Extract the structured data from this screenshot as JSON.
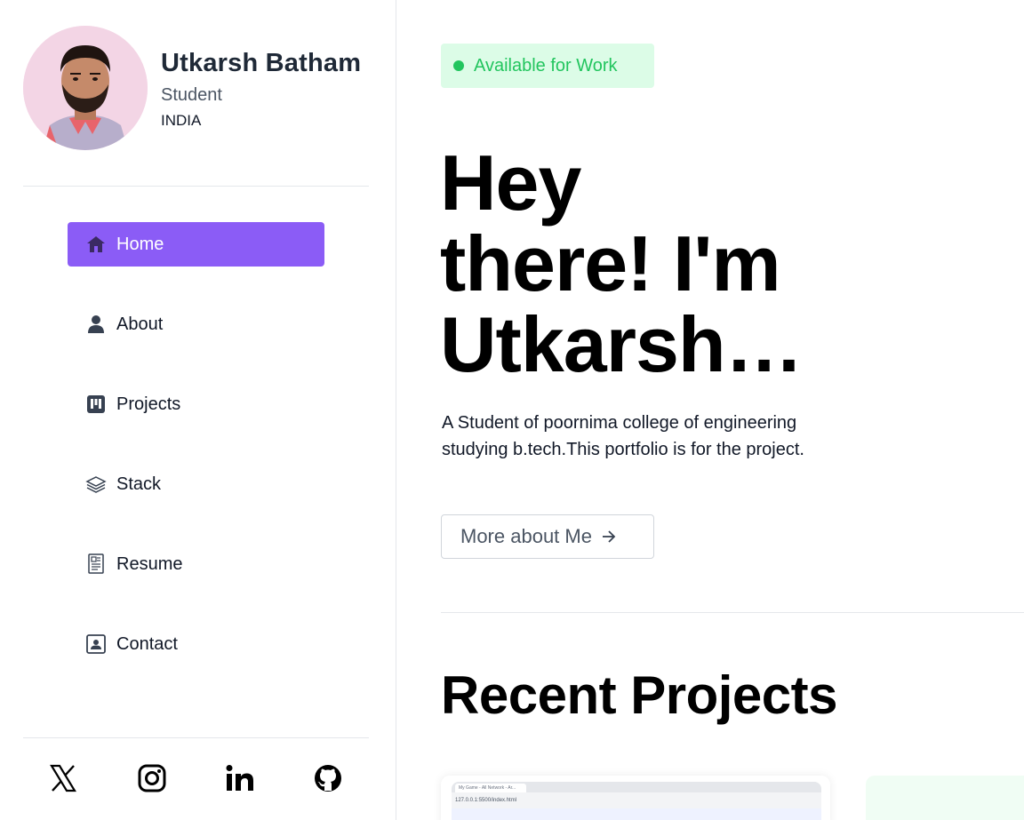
{
  "profile": {
    "name": "Utkarsh Batham",
    "role": "Student",
    "country": "INDIA"
  },
  "nav": {
    "items": [
      {
        "label": "Home",
        "icon": "home-icon",
        "active": true
      },
      {
        "label": "About",
        "icon": "user-icon",
        "active": false
      },
      {
        "label": "Projects",
        "icon": "kanban-icon",
        "active": false
      },
      {
        "label": "Stack",
        "icon": "layers-icon",
        "active": false
      },
      {
        "label": "Resume",
        "icon": "document-icon",
        "active": false
      },
      {
        "label": "Contact",
        "icon": "contact-card-icon",
        "active": false
      }
    ]
  },
  "socials": [
    "x-icon",
    "instagram-icon",
    "linkedin-icon",
    "github-icon"
  ],
  "main": {
    "badge": "Available for Work",
    "hero_line1": "Hey",
    "hero_line2": "there! I'm",
    "hero_line3": "Utkarsh…",
    "description": "A Student of poornima college of engineering studying b.tech.This portfolio is for the project.",
    "more_button": "More about Me",
    "section_title": "Recent Projects"
  },
  "project_preview": {
    "tab_title": "My Game - All Network - Ar...",
    "url": "127.0.0.1:5500/index.html"
  },
  "colors": {
    "accent": "#8b5cf6",
    "badge_bg": "#dcfce7",
    "badge_text": "#22c55e",
    "border": "#e5e7eb"
  }
}
